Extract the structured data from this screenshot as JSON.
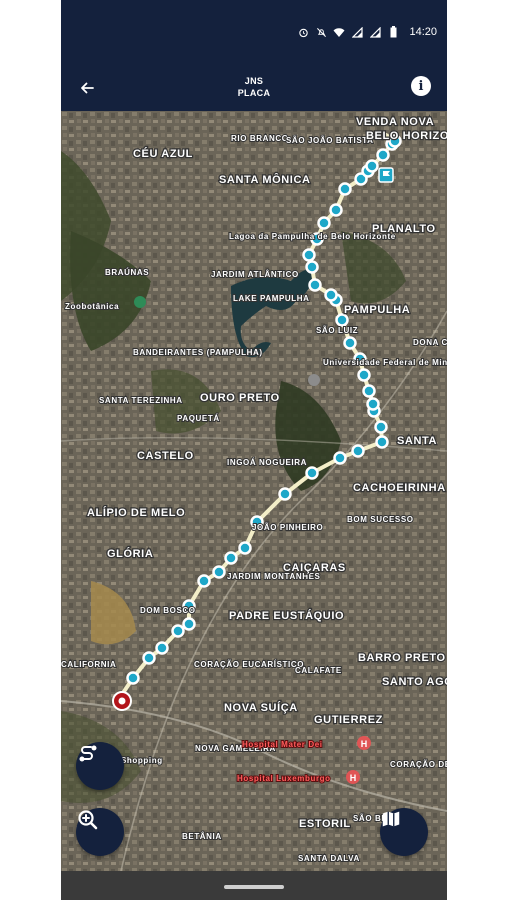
{
  "status_bar": {
    "time": "14:20",
    "icons": [
      "alarm-icon",
      "mute-icon",
      "wifi-icon",
      "signal-icon",
      "signal-icon",
      "battery-icon"
    ]
  },
  "app_bar": {
    "title": "JNS",
    "subtitle": "PLACA",
    "back_icon": "arrow-left-icon",
    "info_icon": "info-icon"
  },
  "map": {
    "labels": [
      "RIO BRANCO",
      "SÃO JOÃO BATISTA",
      "VENDA NOVA",
      "BELO HORIZONTE",
      "CÉU AZUL",
      "SANTA MÔNICA",
      "PLANALTO",
      "Lagoa da Pampulha de Belo Horizonte",
      "BRAÚNAS",
      "JARDIM ATLÂNTICO",
      "LAKE PAMPULHA",
      "PAMPULHA",
      "Zoobotânica",
      "BANDEIRANTES (PAMPULHA)",
      "SÃO LUIZ",
      "DONA CLARA",
      "Universidade Federal de Minas Gerais",
      "OURO PRETO",
      "SANTA TEREZINHA",
      "PAQUETÁ",
      "CASTELO",
      "SANTA",
      "INGOÁ NOGUEIRA",
      "CACHOEIRINHA",
      "ALÍPIO DE MELO",
      "JOÃO PINHEIRO",
      "BOM SUCESSO",
      "GLÓRIA",
      "JARDIM MONTANHES",
      "CAIÇARAS",
      "DOM BOSCO",
      "PADRE EUSTÁQUIO",
      "CALIFORNIA",
      "CORAÇÃO EUCARÍSTICO",
      "CALAFATE",
      "BARRO PRETO",
      "SANTO AGOSTINHO",
      "NOVA SUÍÇA",
      "GUTIERREZ",
      "NOVA GAMELEIRA",
      "Hospital Mater Dei",
      "Hospital Luxemburgo",
      "CORAÇÃO DE JESUS",
      "ESTORIL",
      "BETÂNIA",
      "SANTA DALVA",
      "SÃO BENTO",
      "Shopping"
    ],
    "route_color": "#1ea7c8",
    "start_marker_color": "#b3151b",
    "end_icon": "flag-icon"
  },
  "fabs": {
    "route_icon": "route-icon",
    "zoom_icon": "zoom-in-icon",
    "layers_icon": "map-icon"
  }
}
